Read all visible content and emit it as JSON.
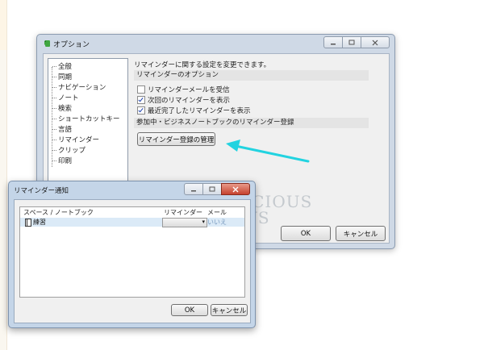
{
  "options_window": {
    "title": "オプション",
    "tree_items": [
      "全般",
      "同期",
      "ナビゲーション",
      "ノート",
      "検索",
      "ショートカットキー",
      "言語",
      "リマインダー",
      "クリップ",
      "印刷"
    ],
    "description": "リマインダーに関する設定を変更できます。",
    "section_options_label": "リマインダーのオプション",
    "checkboxes": [
      {
        "label": "リマインダーメールを受信",
        "checked": false
      },
      {
        "label": "次回のリマインダーを表示",
        "checked": true
      },
      {
        "label": "最近完了したリマインダーを表示",
        "checked": true
      }
    ],
    "section_shared_label": "参加中・ビジネスノートブックのリマインダー登録",
    "manage_button": "リマインダー登録の管理",
    "ok_button": "OK",
    "cancel_button": "キャンセル",
    "caption_icons": [
      "minimize-icon",
      "maximize-icon",
      "close-icon"
    ]
  },
  "reminder_dialog": {
    "title": "リマインダー通知",
    "columns": [
      "スペース / ノートブック",
      "リマインダー",
      "メール"
    ],
    "rows": [
      {
        "name": "練習",
        "reminder_value": "",
        "email_value": "いいえ"
      }
    ],
    "ok_button": "OK",
    "cancel_button": "キャンセル"
  },
  "watermark": {
    "line1": "PRECIOUS",
    "line2": "DAYS"
  },
  "colors": {
    "arrow": "#22d3e0",
    "selected_row": "#dbeaf7",
    "close_button": "#c6412d"
  }
}
